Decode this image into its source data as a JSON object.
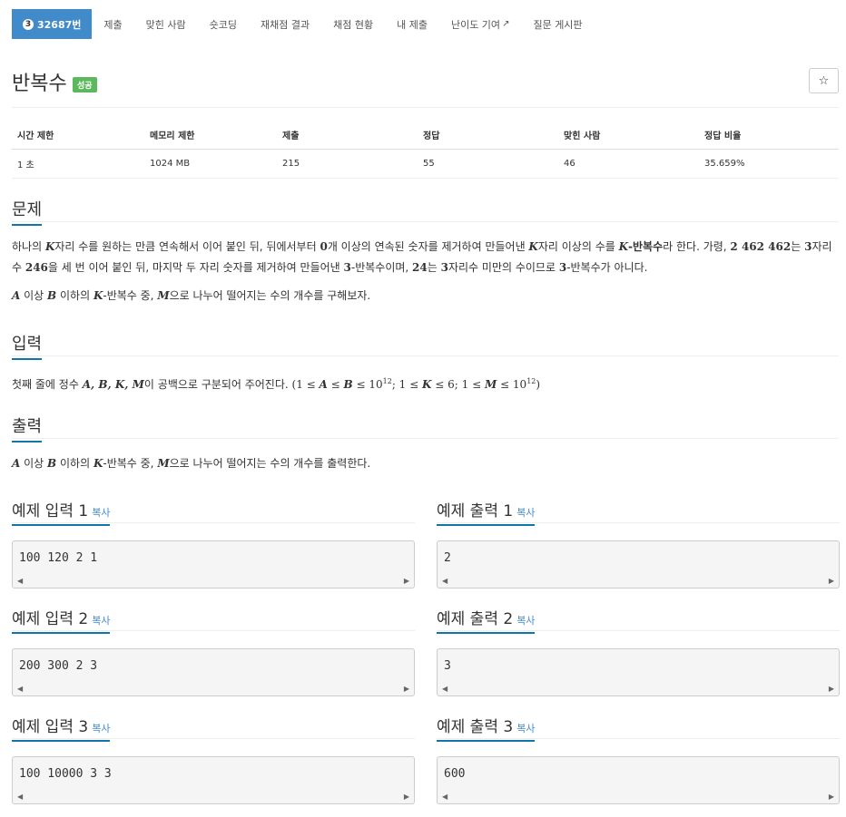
{
  "nav": {
    "problem_number": "32687번",
    "problem_badge": "3",
    "items": [
      "제출",
      "맞힌 사람",
      "숏코딩",
      "재채점 결과",
      "채점 현황",
      "내 제출",
      "난이도 기여",
      "질문 게시판"
    ]
  },
  "title": {
    "text": "반복수",
    "status": "성공",
    "star": "☆"
  },
  "info": {
    "headers": [
      "시간 제한",
      "메모리 제한",
      "제출",
      "정답",
      "맞힌 사람",
      "정답 비율"
    ],
    "values": [
      "1 초",
      "1024 MB",
      "215",
      "55",
      "46",
      "35.659%"
    ]
  },
  "problem": {
    "heading": "문제",
    "p1_a": "하나의 ",
    "p1_k1": "K",
    "p1_b": "자리 수를 원하는 만큼 연속해서 이어 붙인 뒤, 뒤에서부터 ",
    "p1_zero": "0",
    "p1_c": "개 이상의 연속된 숫자를 제거하여 만들어낸 ",
    "p1_k2": "K",
    "p1_d": "자리 이상의 수를 ",
    "p1_bold": "K",
    "p1_bold2": "-반복수",
    "p1_e": "라 한다. 가령, ",
    "p1_num": "2 462 462",
    "p1_f": "는 ",
    "p1_three": "3",
    "p1_g": "자리 수 ",
    "p1_246": "246",
    "p1_h": "을 세 번 이어 붙인 뒤, 마지막 두 자리 숫자를 제거하여 만들어낸 ",
    "p1_3b": "3",
    "p1_i": "-반복수이며, ",
    "p1_24": "24",
    "p1_j": "는 ",
    "p1_3c": "3",
    "p1_k": "자리수 미만의 수이므로 ",
    "p1_3d": "3",
    "p1_l": "-반복수가 아니다.",
    "p2_a": "A",
    "p2_b": " 이상 ",
    "p2_c": "B",
    "p2_d": " 이하의 ",
    "p2_e": "K",
    "p2_f": "-반복수 중, ",
    "p2_g": "M",
    "p2_h": "으로 나누어 떨어지는 수의 개수를 구해보자."
  },
  "input": {
    "heading": "입력",
    "a": "첫째 줄에 정수 ",
    "vars": "A, B, K, M",
    "b": "이 공백으로 구분되어 주어진다. ",
    "cond_a": "(1 ≤ ",
    "cond_A": "A",
    "cond_b": " ≤ ",
    "cond_B": "B",
    "cond_c": " ≤ 10",
    "cond_e1": "12",
    "cond_d": "; 1 ≤ ",
    "cond_K": "K",
    "cond_e": " ≤ 6; 1 ≤ ",
    "cond_M": "M",
    "cond_f": " ≤ 10",
    "cond_e2": "12",
    "cond_g": ")"
  },
  "output": {
    "heading": "출력",
    "a": "A",
    "b": " 이상 ",
    "c": "B",
    "d": " 이하의 ",
    "e": "K",
    "f": "-반복수 중, ",
    "g": "M",
    "h": "으로 나누어 떨어지는 수의 개수를 출력한다."
  },
  "samples": {
    "copy": "복사",
    "in1_title": "예제 입력 1",
    "in1": "100 120 2 1",
    "out1_title": "예제 출력 1",
    "out1": "2",
    "in2_title": "예제 입력 2",
    "in2": "200 300 2 3",
    "out2_title": "예제 출력 2",
    "out2": "3",
    "in3_title": "예제 입력 3",
    "in3": "100 10000 3 3",
    "out3_title": "예제 출력 3",
    "out3": "600"
  }
}
